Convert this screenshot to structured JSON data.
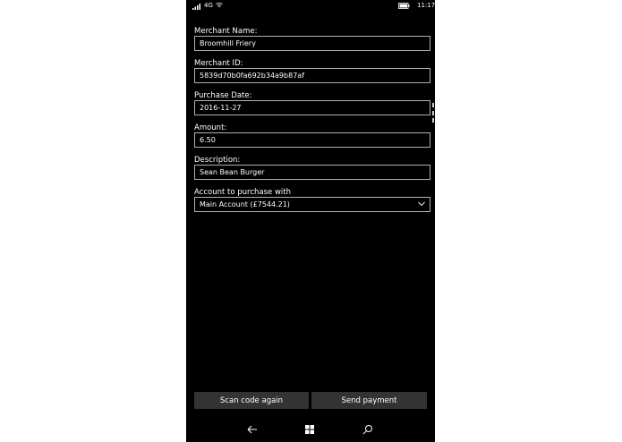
{
  "status_bar": {
    "network": "4G",
    "time": "11:17"
  },
  "form": {
    "merchant_name": {
      "label": "Merchant Name:",
      "value": "Broomhill Friery"
    },
    "merchant_id": {
      "label": "Merchant ID:",
      "value": "5839d70b0fa692b34a9b87af"
    },
    "purchase_date": {
      "label": "Purchase Date:",
      "value": "2016-11-27"
    },
    "amount": {
      "label": "Amount:",
      "value": "6.50"
    },
    "description": {
      "label": "Description:",
      "value": "Sean Bean Burger"
    },
    "account": {
      "label": "Account to purchase with",
      "value": "Main Account (£7544.21)"
    }
  },
  "buttons": {
    "scan": "Scan code again",
    "send": "Send payment"
  },
  "icons": {
    "signal": "signal-icon",
    "wifi": "wifi-icon",
    "battery": "battery-icon",
    "chevron": "chevron-down-icon",
    "back": "back-arrow-icon",
    "start": "windows-start-icon",
    "search": "search-icon"
  },
  "colors": {
    "background": "#000000",
    "text": "#ffffff",
    "border": "#b0b0b0",
    "button": "#333333"
  }
}
